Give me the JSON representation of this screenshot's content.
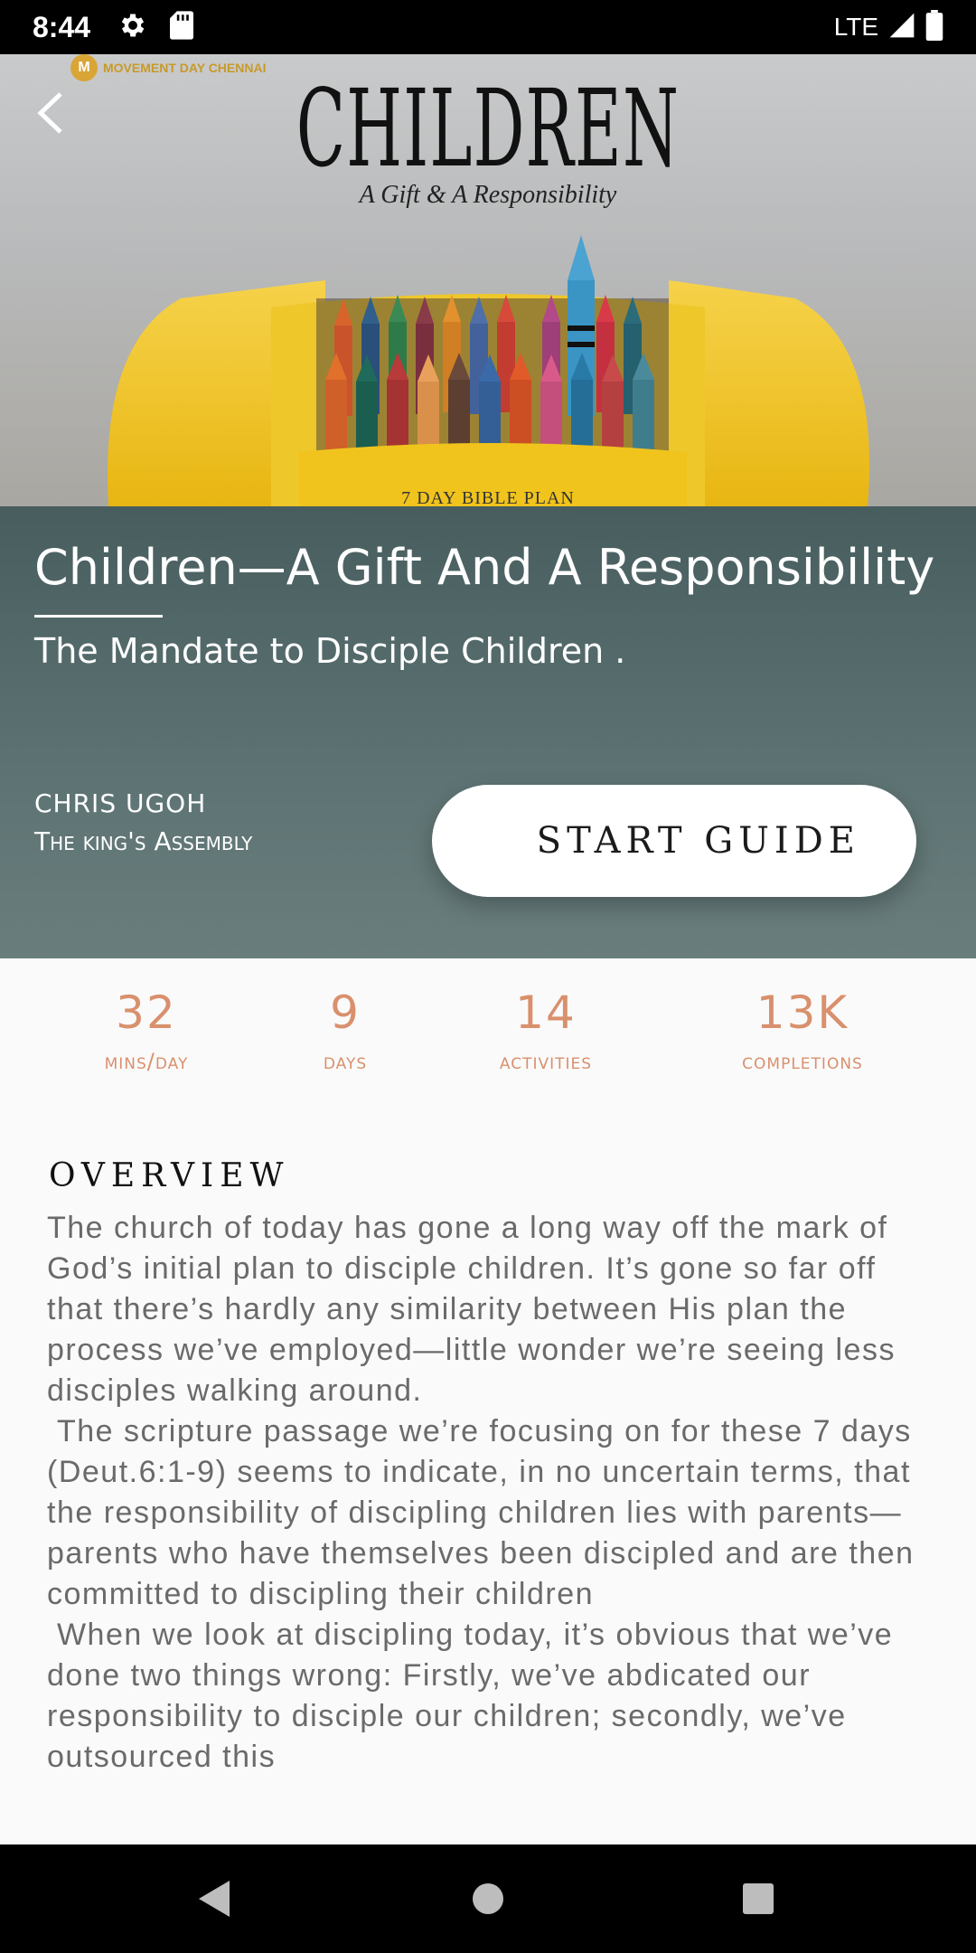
{
  "status_bar": {
    "time": "8:44",
    "network": "LTE"
  },
  "hero": {
    "logo_text": "MOVEMENT DAY CHENNAI",
    "logo_initial": "M",
    "image_title": "CHILDREN",
    "image_subtitle": "A Gift & A Responsibility",
    "image_caption": "7 DAY BIBLE PLAN"
  },
  "plan": {
    "title": "Children—A Gift And A Responsibility",
    "subtitle": "The Mandate to Disciple Children .",
    "author": "CHRIS UGOH",
    "organization": "The king's Assembly",
    "start_label": "START GUIDE"
  },
  "stats": [
    {
      "value": "32",
      "label": "mins/day"
    },
    {
      "value": "9",
      "label": "days"
    },
    {
      "value": "14",
      "label": "activities"
    },
    {
      "value": "13K",
      "label": "completions"
    }
  ],
  "overview": {
    "heading": "OVERVIEW",
    "body": "The church of today has gone a long way off the mark of God’s initial plan to disciple children. It’s gone so far off that there’s hardly any similarity between His plan the process we’ve employed—little wonder we’re seeing less disciples walking around.\n The scripture passage we’re focusing on for these 7 days (Deut.6:1-9) seems to indicate, in no uncertain terms, that the responsibility of discipling children lies with parents—parents who have themselves been discipled and are then committed to discipling their children\n When we look at discipling today, it’s obvious that we’ve done two things wrong: Firstly, we’ve abdicated our responsibility to disciple our children; secondly, we’ve outsourced this"
  },
  "colors": {
    "panel": "#566b6c",
    "accent": "#d9906d",
    "crayon_box": "#f0c41c"
  },
  "icons": {
    "back": "chevron-left-icon",
    "settings": "gear-icon",
    "sd_card": "sd-card-icon",
    "signal": "signal-icon",
    "battery": "battery-icon",
    "nav_back": "triangle-back-icon",
    "nav_home": "circle-home-icon",
    "nav_recents": "square-recents-icon"
  }
}
